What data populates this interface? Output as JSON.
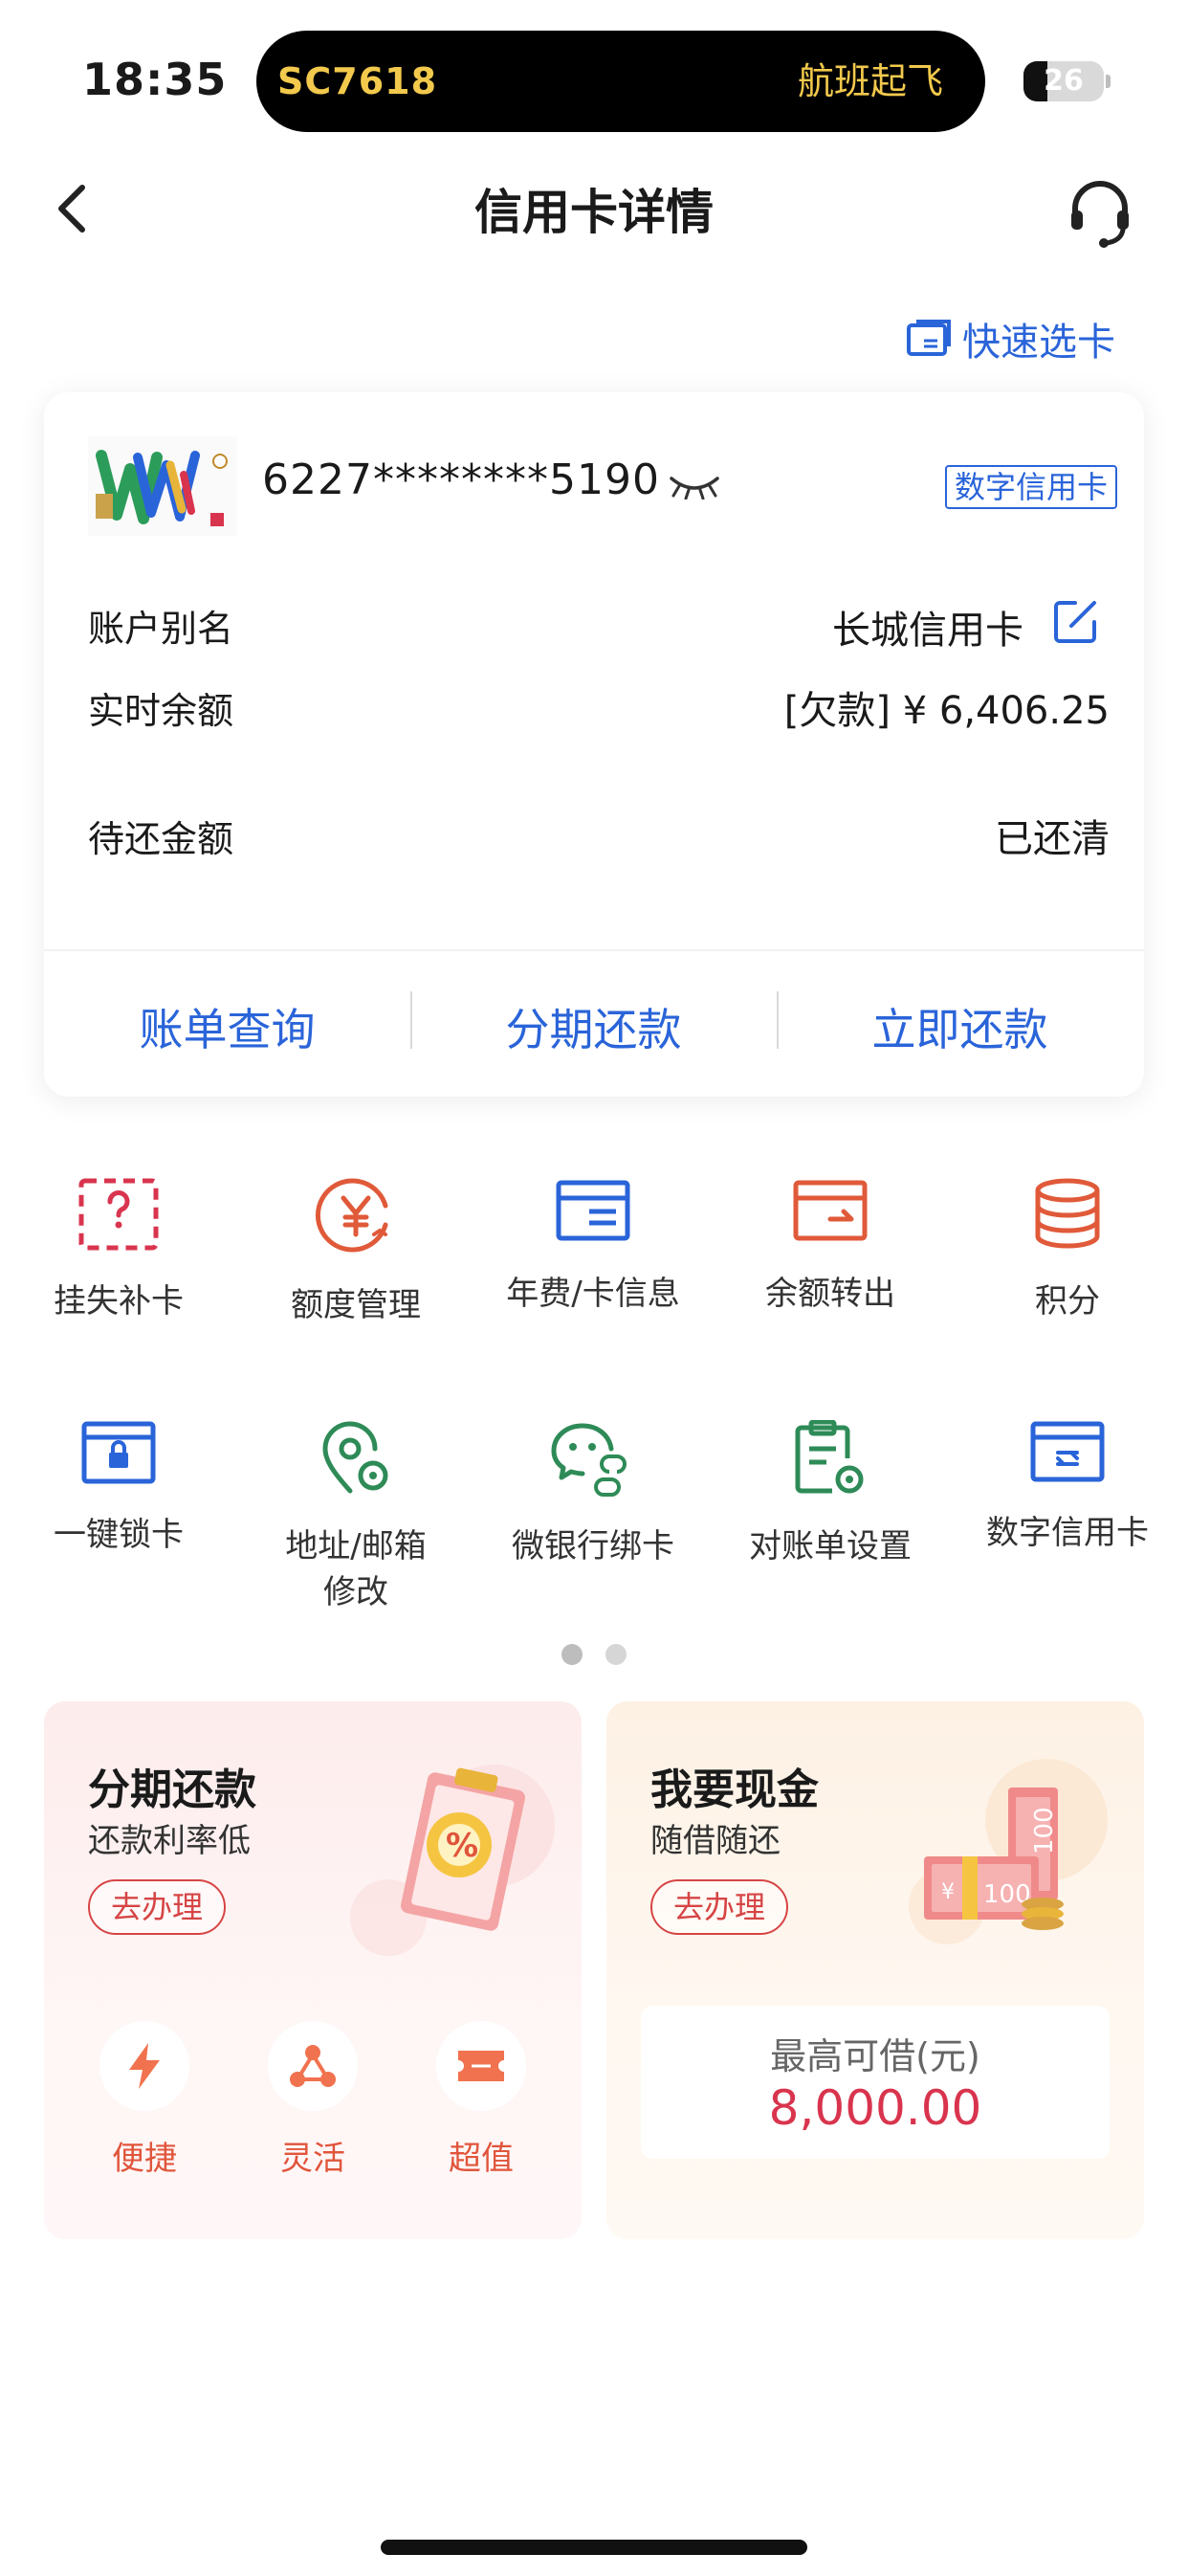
{
  "status_bar": {
    "time": "18:35",
    "live_activity": {
      "flight": "SC7618",
      "status": "航班起飞"
    },
    "battery": "26"
  },
  "nav": {
    "title": "信用卡详情",
    "back_icon": "chevron-left-icon",
    "service_icon": "headset-icon"
  },
  "quick_select": {
    "label": "快速选卡"
  },
  "card": {
    "number": "6227********5190",
    "badge": "数字信用卡",
    "rows": {
      "alias_label": "账户别名",
      "alias_value": "长城信用卡",
      "balance_label": "实时余额",
      "balance_value": "[欠款] ¥ 6,406.25",
      "due_label": "待还金额",
      "due_value": "已还清"
    },
    "actions": [
      "账单查询",
      "分期还款",
      "立即还款"
    ]
  },
  "services": [
    {
      "label": "挂失补卡",
      "icon": "card-question-icon",
      "color": "#d9344e"
    },
    {
      "label": "额度管理",
      "icon": "yen-circle-icon",
      "color": "#e05a3a"
    },
    {
      "label": "年费/卡信息",
      "icon": "card-info-icon",
      "color": "#2a64d9"
    },
    {
      "label": "余额转出",
      "icon": "card-transfer-icon",
      "color": "#e05a3a"
    },
    {
      "label": "积分",
      "icon": "coin-stack-icon",
      "color": "#e05a3a"
    },
    {
      "label": "一键锁卡",
      "icon": "card-lock-icon",
      "color": "#2a64d9"
    },
    {
      "label": "地址/邮箱\n修改",
      "label_line1": "地址/邮箱",
      "label_line2": "修改",
      "icon": "location-settings-icon",
      "color": "#2e8b57"
    },
    {
      "label": "微银行绑卡",
      "icon": "wechat-link-icon",
      "color": "#2e8b57"
    },
    {
      "label": "对账单设置",
      "icon": "statement-settings-icon",
      "color": "#2e8b57"
    },
    {
      "label": "数字信用卡",
      "icon": "digital-card-icon",
      "color": "#2a64d9"
    }
  ],
  "promo": {
    "installment": {
      "title": "分期还款",
      "subtitle": "还款利率低",
      "button": "去办理",
      "features": [
        "便捷",
        "灵活",
        "超值"
      ]
    },
    "cash": {
      "title": "我要现金",
      "subtitle": "随借随还",
      "button": "去办理",
      "limit_label": "最高可借(元)",
      "limit_value": "8,000.00"
    }
  },
  "colors": {
    "accent_blue": "#2a64d9",
    "accent_red": "#d9344e",
    "accent_green": "#2e8b57",
    "accent_orange": "#e05a3a"
  }
}
